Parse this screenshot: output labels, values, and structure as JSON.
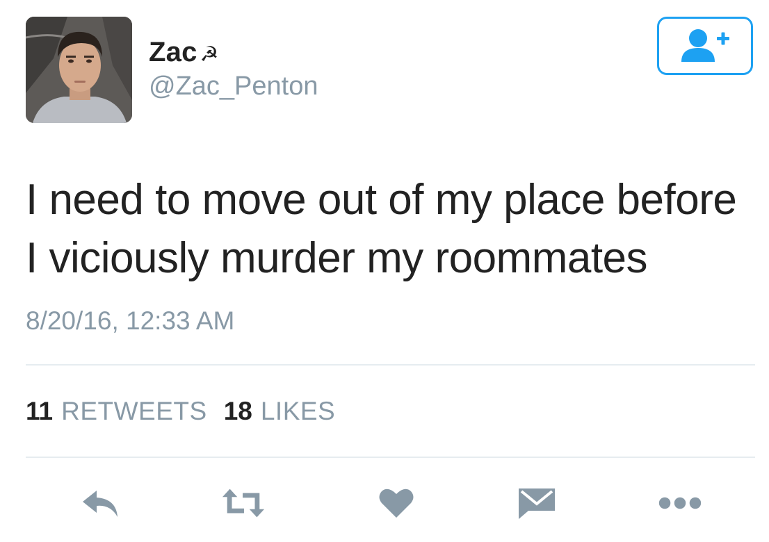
{
  "user": {
    "display_name": "Zac",
    "name_emoji": "☭",
    "handle": "@Zac_Penton",
    "avatar_icon": "profile-photo"
  },
  "follow_button": {
    "icon": "add-user-icon",
    "accent_color": "#1da1f2"
  },
  "tweet": {
    "text": "I need to move out of my place before I viciously murder my roommates",
    "timestamp": "8/20/16, 12:33 AM"
  },
  "stats": {
    "retweets_count": "11",
    "retweets_label": "RETWEETS",
    "likes_count": "18",
    "likes_label": "LIKES"
  },
  "actions": [
    {
      "icon": "reply-icon"
    },
    {
      "icon": "retweet-icon"
    },
    {
      "icon": "heart-icon"
    },
    {
      "icon": "direct-message-icon"
    },
    {
      "icon": "more-icon"
    }
  ],
  "colors": {
    "secondary_text": "#8899a6",
    "icon_gray": "#8899a6",
    "divider": "#e6ecf0"
  }
}
